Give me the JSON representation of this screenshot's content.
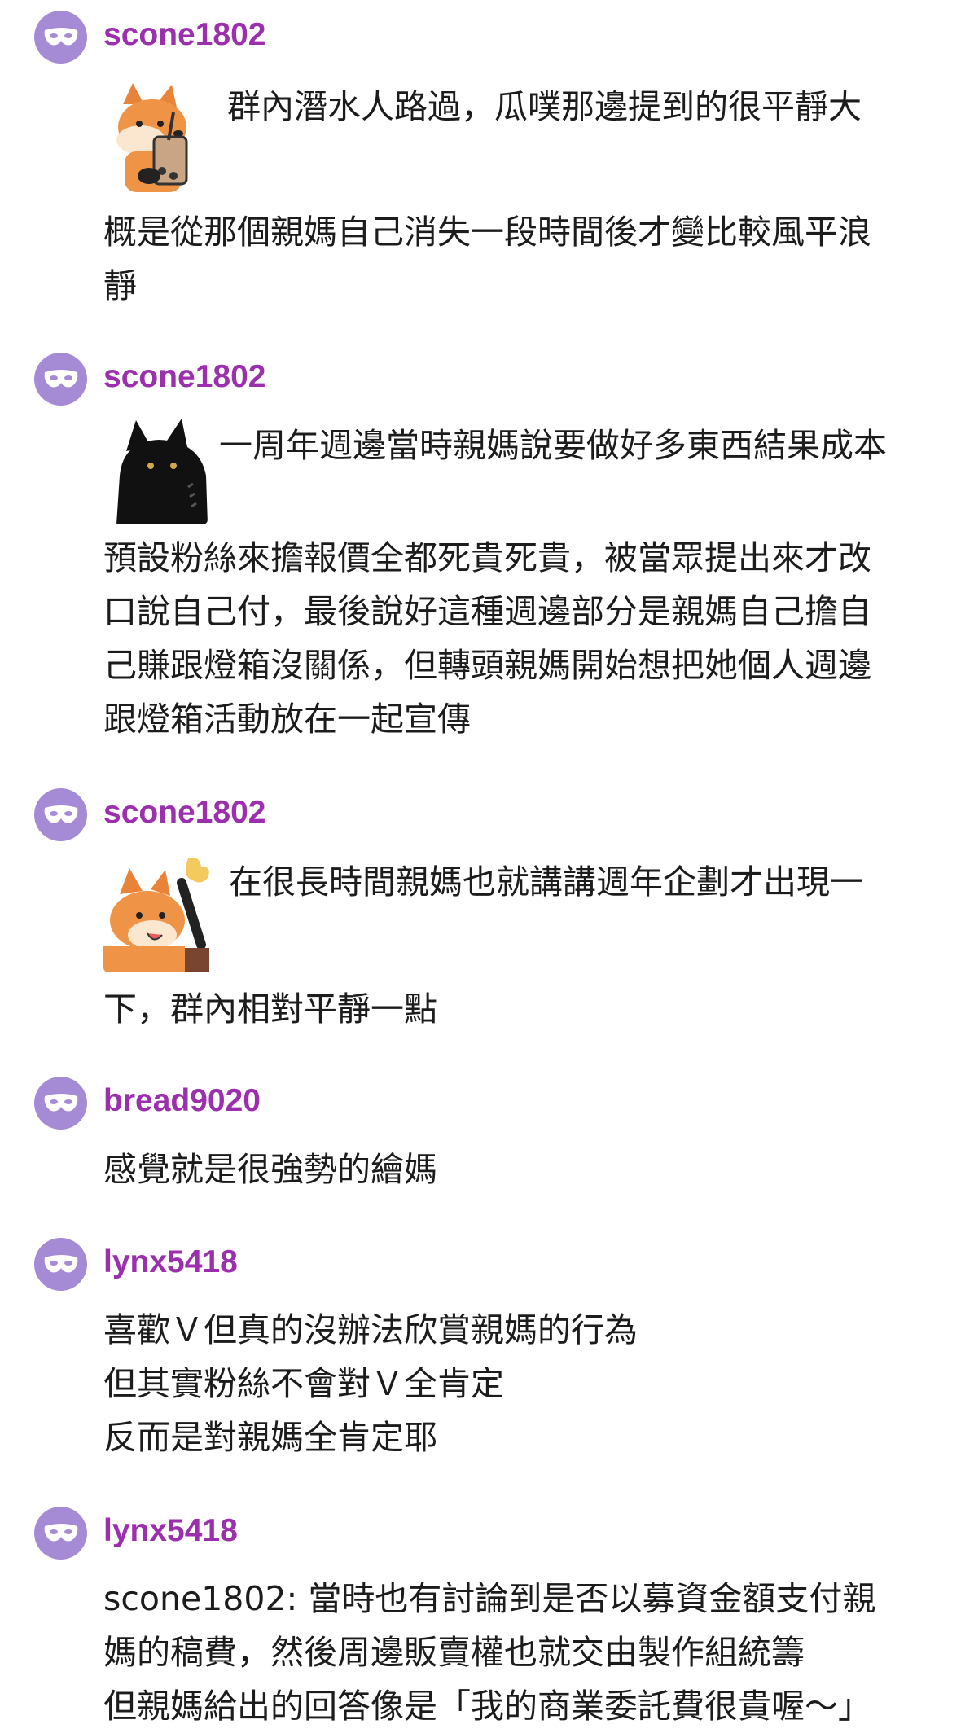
{
  "comments": [
    {
      "username": "scone1802",
      "sticker": "fox-bubble-tea-sticker",
      "text_first": "群內潛水人路過，瓜噗那邊提到的很平靜大",
      "text_rest": [
        "概是從那個親媽自己消失一段時間後才變比較風平浪",
        "靜"
      ]
    },
    {
      "username": "scone1802",
      "sticker": "black-cat-sticker",
      "text_first": "一周年週邊當時親媽說要做好多東西結果成本",
      "text_rest": [
        "預設粉絲來擔報價全都死貴死貴，被當眾提出來才改",
        "口說自己付，最後說好這種週邊部分是親媽自己擔自",
        "己賺跟燈箱沒關係，但轉頭親媽開始想把她個人週邊",
        "跟燈箱活動放在一起宣傳"
      ]
    },
    {
      "username": "scone1802",
      "sticker": "fox-waving-sticker",
      "text_first": "在很長時間親媽也就講講週年企劃才出現一",
      "text_rest": [
        "下，群內相對平靜一點"
      ]
    },
    {
      "username": "bread9020",
      "lines": [
        "感覺就是很強勢的繪媽"
      ]
    },
    {
      "username": "lynx5418",
      "lines": [
        "喜歡Ｖ但真的沒辦法欣賞親媽的行為",
        "但其實粉絲不會對Ｖ全肯定",
        "反而是對親媽全肯定耶"
      ]
    },
    {
      "username": "lynx5418",
      "lines": [
        "scone1802: 當時也有討論到是否以募資金額支付親",
        "媽的稿費，然後周邊販賣權也就交由製作組統籌",
        "但親媽給出的回答像是「我的商業委託費很貴喔～」"
      ]
    }
  ],
  "colors": {
    "username": "#9b2fae",
    "avatar_bg": "#a58ad6",
    "text": "#1c1c1c"
  },
  "icons": {
    "avatar": "mask-icon"
  }
}
